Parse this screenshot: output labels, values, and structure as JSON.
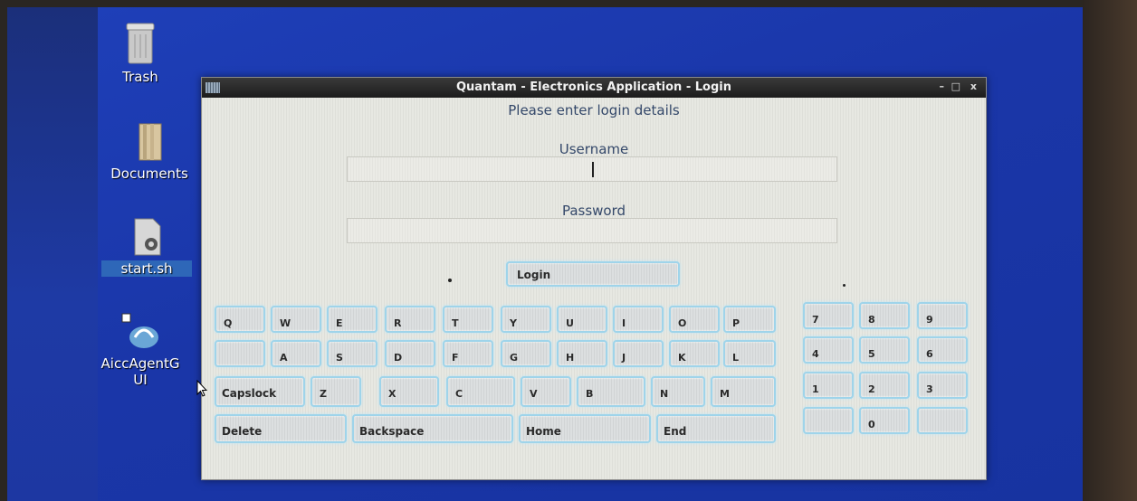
{
  "desktop": {
    "icons": [
      {
        "label": "Trash",
        "icon": "trash-icon"
      },
      {
        "label": "Documents",
        "icon": "folder-icon"
      },
      {
        "label": "start.sh",
        "icon": "script-file-icon"
      },
      {
        "label": "AiccAgentG\nUI",
        "icon": "agent-app-icon"
      }
    ]
  },
  "window": {
    "title": "Quantam - Electronics Application - Login",
    "controls": {
      "minimize": "–",
      "maximize": "□",
      "close": "x"
    },
    "prompt": "Please enter login details",
    "username": {
      "label": "Username",
      "value": ""
    },
    "password": {
      "label": "Password",
      "value": ""
    },
    "login_label": "Login"
  },
  "keyboard": {
    "row1": [
      "Q",
      "W",
      "E",
      "R",
      "T",
      "Y",
      "U",
      "I",
      "O",
      "P"
    ],
    "row2": [
      "",
      "A",
      "S",
      "D",
      "F",
      "G",
      "H",
      "J",
      "K",
      "L"
    ],
    "row3": [
      "Capslock",
      "Z",
      "X",
      "C",
      "V",
      "B",
      "N",
      "M"
    ],
    "row4": [
      "Delete",
      "Backspace",
      "Home",
      "End"
    ],
    "numpad": [
      "7",
      "8",
      "9",
      "4",
      "5",
      "6",
      "1",
      "2",
      "3",
      "",
      "0",
      ""
    ]
  },
  "colors": {
    "key_border": "#9fd4ea",
    "desktop_blue": "#1e3fb8",
    "title_bar": "#1c1c1c"
  }
}
